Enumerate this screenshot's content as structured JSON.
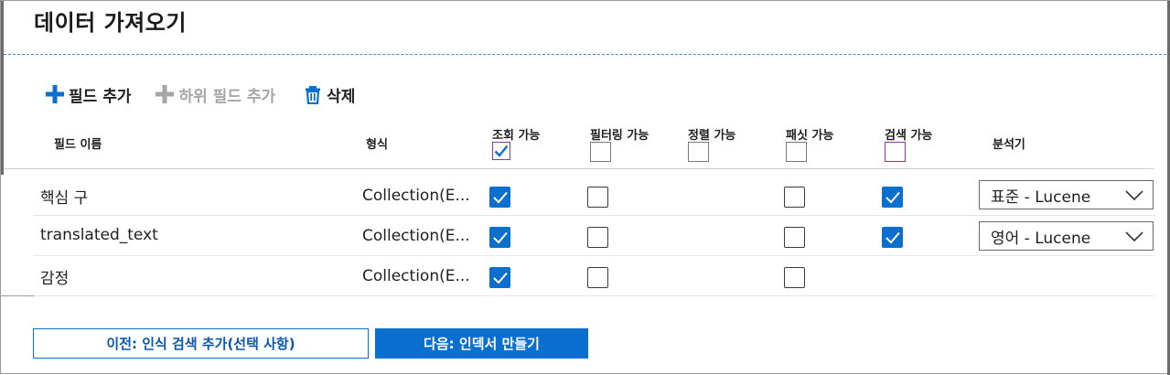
{
  "title": "데이터 가져오기",
  "toolbar": {
    "add_field": "필드 추가",
    "add_subfield": "하위 필드 추가",
    "delete": "삭제"
  },
  "columns": {
    "field_name": "필드 이름",
    "type": "형식",
    "retrievable": "조회 가능",
    "filterable": "필터링 가능",
    "sortable": "정렬 가능",
    "facetable": "패싯 가능",
    "searchable": "검색 가능",
    "analyzer": "분석기"
  },
  "header_checks": {
    "retrievable": true,
    "filterable": false,
    "sortable": false,
    "facetable": false,
    "searchable": false
  },
  "rows": [
    {
      "name": "핵심 구",
      "type": "Collection(E...",
      "retrievable": true,
      "filterable": false,
      "facetable": false,
      "searchable": true,
      "analyzer": "표준 - Lucene"
    },
    {
      "name": "translated_text",
      "type": "Collection(E...",
      "retrievable": true,
      "filterable": false,
      "facetable": false,
      "searchable": true,
      "analyzer": "영어 - Lucene"
    },
    {
      "name": "감정",
      "type": "Collection(E...",
      "retrievable": true,
      "filterable": false,
      "facetable": false,
      "searchable": null,
      "analyzer": null
    }
  ],
  "buttons": {
    "previous": "이전: 인식 검색 추가(선택 사항)",
    "next": "다음: 인덱서 만들기"
  },
  "colors": {
    "accent": "#0b6fd0",
    "disabled": "#a6a6a6",
    "focus_border": "#8a3aa8"
  },
  "icons": {
    "add_field": "plus-icon",
    "add_subfield": "plus-icon",
    "delete": "trash-icon",
    "dropdown": "chevron-down-icon",
    "check": "checkmark-icon"
  }
}
